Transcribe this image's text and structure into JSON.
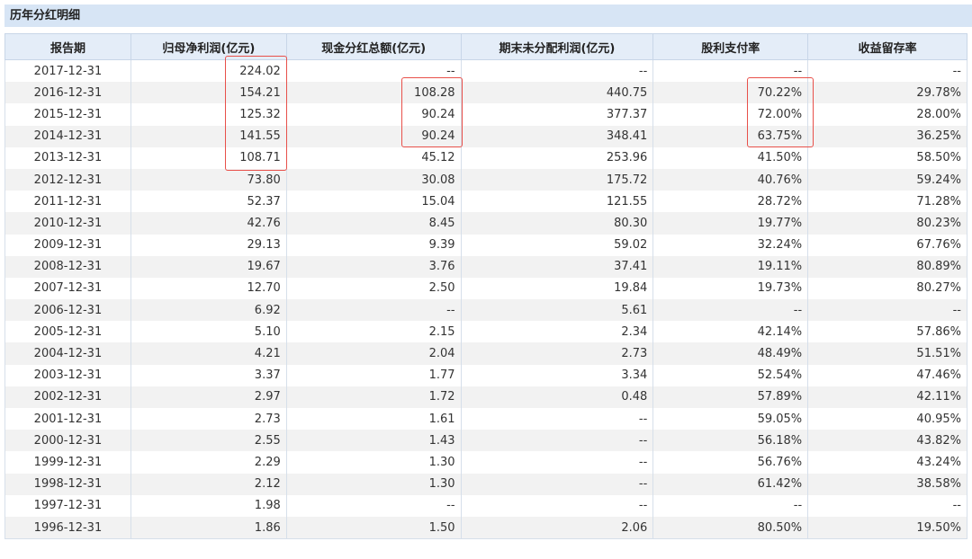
{
  "title": "历年分红明细",
  "headers": [
    "报告期",
    "归母净利润(亿元)",
    "现金分红总额(亿元)",
    "期末未分配利润(亿元)",
    "股利支付率",
    "收益留存率"
  ],
  "rows": [
    [
      "2017-12-31",
      "224.02",
      "--",
      "--",
      "--",
      "--"
    ],
    [
      "2016-12-31",
      "154.21",
      "108.28",
      "440.75",
      "70.22%",
      "29.78%"
    ],
    [
      "2015-12-31",
      "125.32",
      "90.24",
      "377.37",
      "72.00%",
      "28.00%"
    ],
    [
      "2014-12-31",
      "141.55",
      "90.24",
      "348.41",
      "63.75%",
      "36.25%"
    ],
    [
      "2013-12-31",
      "108.71",
      "45.12",
      "253.96",
      "41.50%",
      "58.50%"
    ],
    [
      "2012-12-31",
      "73.80",
      "30.08",
      "175.72",
      "40.76%",
      "59.24%"
    ],
    [
      "2011-12-31",
      "52.37",
      "15.04",
      "121.55",
      "28.72%",
      "71.28%"
    ],
    [
      "2010-12-31",
      "42.76",
      "8.45",
      "80.30",
      "19.77%",
      "80.23%"
    ],
    [
      "2009-12-31",
      "29.13",
      "9.39",
      "59.02",
      "32.24%",
      "67.76%"
    ],
    [
      "2008-12-31",
      "19.67",
      "3.76",
      "37.41",
      "19.11%",
      "80.89%"
    ],
    [
      "2007-12-31",
      "12.70",
      "2.50",
      "19.84",
      "19.73%",
      "80.27%"
    ],
    [
      "2006-12-31",
      "6.92",
      "--",
      "5.61",
      "--",
      "--"
    ],
    [
      "2005-12-31",
      "5.10",
      "2.15",
      "2.34",
      "42.14%",
      "57.86%"
    ],
    [
      "2004-12-31",
      "4.21",
      "2.04",
      "2.73",
      "48.49%",
      "51.51%"
    ],
    [
      "2003-12-31",
      "3.37",
      "1.77",
      "3.34",
      "52.54%",
      "47.46%"
    ],
    [
      "2002-12-31",
      "2.97",
      "1.72",
      "0.48",
      "57.89%",
      "42.11%"
    ],
    [
      "2001-12-31",
      "2.73",
      "1.61",
      "--",
      "59.05%",
      "40.95%"
    ],
    [
      "2000-12-31",
      "2.55",
      "1.43",
      "--",
      "56.18%",
      "43.82%"
    ],
    [
      "1999-12-31",
      "2.29",
      "1.30",
      "--",
      "56.76%",
      "43.24%"
    ],
    [
      "1998-12-31",
      "2.12",
      "1.30",
      "--",
      "61.42%",
      "38.58%"
    ],
    [
      "1997-12-31",
      "1.98",
      "--",
      "--",
      "--",
      "--"
    ],
    [
      "1996-12-31",
      "1.86",
      "1.50",
      "2.06",
      "80.50%",
      "19.50%"
    ]
  ],
  "highlight_color": "#e8504a"
}
